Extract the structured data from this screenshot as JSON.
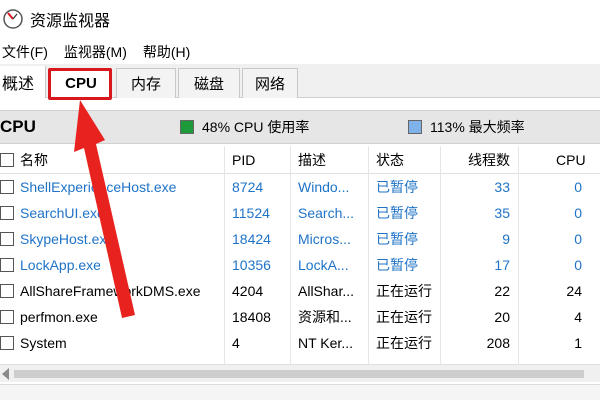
{
  "window": {
    "title": "资源监视器"
  },
  "menu": [
    "文件(F)",
    "监视器(M)",
    "帮助(H)"
  ],
  "tabs": [
    "概述",
    "CPU",
    "内存",
    "磁盘",
    "网络"
  ],
  "section": {
    "title": "CPU",
    "usage_label": "48% CPU 使用率",
    "freq_label": "113% 最大频率",
    "usage_color": "#1d9a3a",
    "freq_color": "#7fb2e8"
  },
  "table": {
    "columns": [
      "名称",
      "PID",
      "描述",
      "状态",
      "线程数",
      "CPU"
    ],
    "rows": [
      {
        "name": "ShellExperienceHost.exe",
        "pid": "8724",
        "desc": "Windo...",
        "status": "已暂停",
        "threads": "33",
        "cpu": "0",
        "paused": true
      },
      {
        "name": "SearchUI.exe",
        "pid": "11524",
        "desc": "Search...",
        "status": "已暂停",
        "threads": "35",
        "cpu": "0",
        "paused": true
      },
      {
        "name": "SkypeHost.exe",
        "pid": "18424",
        "desc": "Micros...",
        "status": "已暂停",
        "threads": "9",
        "cpu": "0",
        "paused": true
      },
      {
        "name": "LockApp.exe",
        "pid": "10356",
        "desc": "LockA...",
        "status": "已暂停",
        "threads": "17",
        "cpu": "0",
        "paused": true
      },
      {
        "name": "AllShareFrameworkDMS.exe",
        "pid": "4204",
        "desc": "AllShar...",
        "status": "正在运行",
        "threads": "22",
        "cpu": "24",
        "paused": false
      },
      {
        "name": "perfmon.exe",
        "pid": "18408",
        "desc": "资源和...",
        "status": "正在运行",
        "threads": "20",
        "cpu": "4",
        "paused": false
      },
      {
        "name": "System",
        "pid": "4",
        "desc": "NT Ker...",
        "status": "正在运行",
        "threads": "208",
        "cpu": "1",
        "paused": false
      }
    ]
  },
  "colors": {
    "paused_text": "#1f73c7",
    "highlight": "#d9181e"
  }
}
